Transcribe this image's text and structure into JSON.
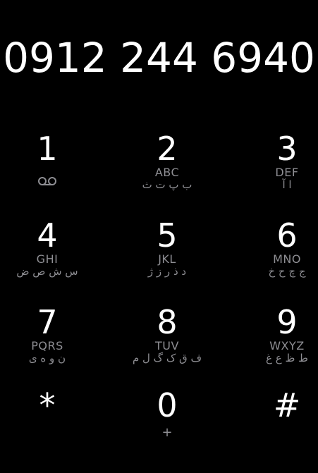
{
  "display": {
    "number": "0912 244 6940"
  },
  "keys": [
    {
      "digit": "1",
      "latin": "",
      "arabic": "",
      "icon": "voicemail-icon"
    },
    {
      "digit": "2",
      "latin": "ABC",
      "arabic": "ب پ ت ث"
    },
    {
      "digit": "3",
      "latin": "DEF",
      "arabic": "ا آ"
    },
    {
      "digit": "4",
      "latin": "GHI",
      "arabic": "س ش ص ض"
    },
    {
      "digit": "5",
      "latin": "JKL",
      "arabic": "د ذ ر ز ژ"
    },
    {
      "digit": "6",
      "latin": "MNO",
      "arabic": "ج چ ح خ"
    },
    {
      "digit": "7",
      "latin": "PQRS",
      "arabic": "ن و ه ی"
    },
    {
      "digit": "8",
      "latin": "TUV",
      "arabic": "ف ق ک گ ل م"
    },
    {
      "digit": "9",
      "latin": "WXYZ",
      "arabic": "ط ظ ع غ"
    },
    {
      "digit": "*",
      "latin": "",
      "arabic": ""
    },
    {
      "digit": "0",
      "latin": "+",
      "arabic": ""
    },
    {
      "digit": "#",
      "latin": "",
      "arabic": ""
    }
  ],
  "colors": {
    "background": "#000000",
    "digit": "#ffffff",
    "subtext": "#8e8e93"
  }
}
